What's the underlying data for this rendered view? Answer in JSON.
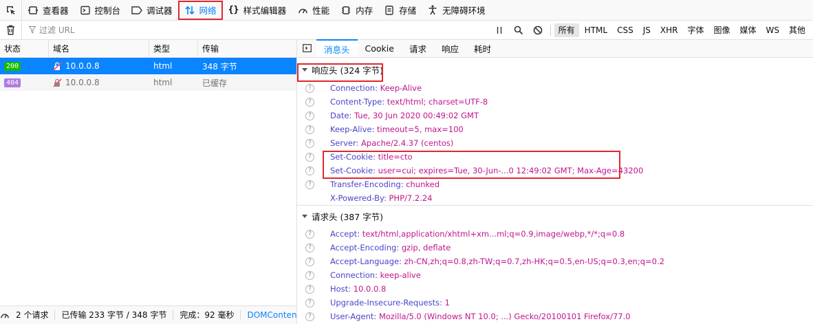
{
  "toolbar": {
    "tools": [
      {
        "label": "查看器",
        "icon": "inspector-icon"
      },
      {
        "label": "控制台",
        "icon": "console-icon"
      },
      {
        "label": "调试器",
        "icon": "debugger-icon"
      },
      {
        "label": "网络",
        "icon": "network-icon",
        "selected": true
      },
      {
        "label": "样式编辑器",
        "icon": "style-editor-icon"
      },
      {
        "label": "性能",
        "icon": "performance-icon"
      },
      {
        "label": "内存",
        "icon": "memory-icon"
      },
      {
        "label": "存储",
        "icon": "storage-icon"
      },
      {
        "label": "无障碍环境",
        "icon": "accessibility-icon"
      }
    ]
  },
  "filterbar": {
    "placeholder": "过滤 URL",
    "types": [
      "所有",
      "HTML",
      "CSS",
      "JS",
      "XHR",
      "字体",
      "图像",
      "媒体",
      "WS",
      "其他"
    ]
  },
  "request_table": {
    "columns": [
      "状态",
      "域名",
      "类型",
      "传输"
    ],
    "rows": [
      {
        "status": "200",
        "domain": "10.0.0.8",
        "type": "html",
        "transfer": "348 字节"
      },
      {
        "status": "404",
        "domain": "10.0.0.8",
        "type": "html",
        "transfer": "已缓存"
      }
    ]
  },
  "statusbar": {
    "requests": "2 个请求",
    "transferred": "已传输 233 字节 / 348 字节",
    "finish": "完成：92 毫秒",
    "domcontent": "DOMContentL"
  },
  "details": {
    "tabs": [
      "消息头",
      "Cookie",
      "请求",
      "响应",
      "耗时"
    ],
    "response_section": "响应头 (324 字节)",
    "response_headers": [
      {
        "name": "Connection:",
        "value": "Keep-Alive"
      },
      {
        "name": "Content-Type:",
        "value": "text/html; charset=UTF-8"
      },
      {
        "name": "Date:",
        "value": "Tue, 30 Jun 2020 00:49:02 GMT"
      },
      {
        "name": "Keep-Alive:",
        "value": "timeout=5, max=100"
      },
      {
        "name": "Server:",
        "value": "Apache/2.4.37 (centos)"
      },
      {
        "name": "Set-Cookie:",
        "value": "title=cto"
      },
      {
        "name": "Set-Cookie:",
        "value": "user=cui; expires=Tue, 30-Jun-...0 12:49:02 GMT; Max-Age=43200"
      },
      {
        "name": "Transfer-Encoding:",
        "value": "chunked"
      },
      {
        "name": "X-Powered-By:",
        "value": "PHP/7.2.24"
      }
    ],
    "request_section": "请求头 (387 字节)",
    "request_headers": [
      {
        "name": "Accept:",
        "value": "text/html,application/xhtml+xm...ml;q=0.9,image/webp,*/*;q=0.8"
      },
      {
        "name": "Accept-Encoding:",
        "value": "gzip, deflate"
      },
      {
        "name": "Accept-Language:",
        "value": "zh-CN,zh;q=0.8,zh-TW;q=0.7,zh-HK;q=0.5,en-US;q=0.3,en;q=0.2"
      },
      {
        "name": "Connection:",
        "value": "keep-alive"
      },
      {
        "name": "Host:",
        "value": "10.0.0.8"
      },
      {
        "name": "Upgrade-Insecure-Requests:",
        "value": "1"
      },
      {
        "name": "User-Agent:",
        "value": "Mozilla/5.0 (Windows NT 10.0; ...) Gecko/20100101 Firefox/77.0"
      }
    ]
  }
}
